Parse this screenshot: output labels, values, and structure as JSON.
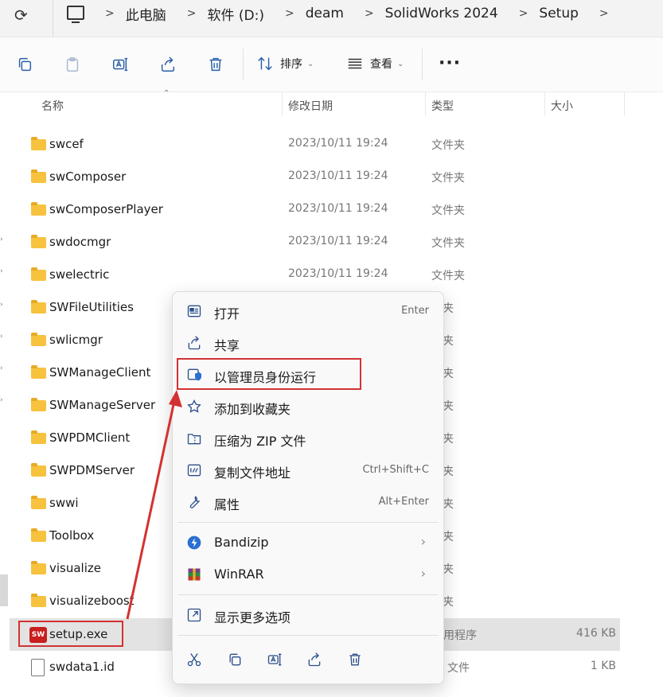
{
  "address_bar": {
    "refresh_icon": "refresh-icon",
    "breadcrumbs": [
      "此电脑",
      "软件 (D:)",
      "deam",
      "SolidWorks 2024",
      "Setup"
    ]
  },
  "toolbar": {
    "sort_label": "排序",
    "view_label": "查看"
  },
  "columns": {
    "name": "名称",
    "date": "修改日期",
    "type": "类型",
    "size": "大小"
  },
  "rows": [
    {
      "name": "swcef",
      "date": "2023/10/11 19:24",
      "type": "文件夹",
      "size": ""
    },
    {
      "name": "swComposer",
      "date": "2023/10/11 19:24",
      "type": "文件夹",
      "size": ""
    },
    {
      "name": "swComposerPlayer",
      "date": "2023/10/11 19:24",
      "type": "文件夹",
      "size": ""
    },
    {
      "name": "swdocmgr",
      "date": "2023/10/11 19:24",
      "type": "文件夹",
      "size": ""
    },
    {
      "name": "swelectric",
      "date": "2023/10/11 19:24",
      "type": "文件夹",
      "size": ""
    },
    {
      "name": "SWFileUtilities",
      "date": "",
      "type": "件夹",
      "size": ""
    },
    {
      "name": "swlicmgr",
      "date": "",
      "type": "件夹",
      "size": ""
    },
    {
      "name": "SWManageClient",
      "date": "",
      "type": "件夹",
      "size": ""
    },
    {
      "name": "SWManageServer",
      "date": "",
      "type": "件夹",
      "size": ""
    },
    {
      "name": "SWPDMClient",
      "date": "",
      "type": "件夹",
      "size": ""
    },
    {
      "name": "SWPDMServer",
      "date": "",
      "type": "件夹",
      "size": ""
    },
    {
      "name": "swwi",
      "date": "",
      "type": "件夹",
      "size": ""
    },
    {
      "name": "Toolbox",
      "date": "",
      "type": "件夹",
      "size": ""
    },
    {
      "name": "visualize",
      "date": "",
      "type": "件夹",
      "size": ""
    },
    {
      "name": "visualizeboost",
      "date": "",
      "type": "件夹",
      "size": ""
    },
    {
      "name": "setup.exe",
      "date": "",
      "type": "用程序",
      "size": "416 KB"
    },
    {
      "name": "swdata1.id",
      "date": "",
      "type": "文件",
      "size": "1 KB"
    }
  ],
  "exe_icon_text": "SW",
  "context_menu": {
    "items": [
      {
        "label": "打开",
        "shortcut": "Enter",
        "icon": "open-icon"
      },
      {
        "label": "共享",
        "shortcut": "",
        "icon": "share-icon"
      },
      {
        "label": "以管理员身份运行",
        "shortcut": "",
        "icon": "shield-icon"
      },
      {
        "label": "添加到收藏夹",
        "shortcut": "",
        "icon": "star-icon"
      },
      {
        "label": "压缩为 ZIP 文件",
        "shortcut": "",
        "icon": "zip-folder-icon"
      },
      {
        "label": "复制文件地址",
        "shortcut": "Ctrl+Shift+C",
        "icon": "copy-path-icon"
      },
      {
        "label": "属性",
        "shortcut": "Alt+Enter",
        "icon": "wrench-icon"
      },
      {
        "label": "Bandizip",
        "shortcut": "",
        "icon": "bandizip-icon"
      },
      {
        "label": "WinRAR",
        "shortcut": "",
        "icon": "winrar-icon"
      },
      {
        "label": "显示更多选项",
        "shortcut": "",
        "icon": "more-options-icon"
      }
    ],
    "bottom_icons": [
      "cut-icon",
      "copy-icon",
      "rename-icon",
      "share-icon",
      "delete-icon"
    ]
  },
  "colors": {
    "highlight_red": "#d33232",
    "accent_blue": "#2a5fa8",
    "folder_yellow": "#f7c23e"
  }
}
